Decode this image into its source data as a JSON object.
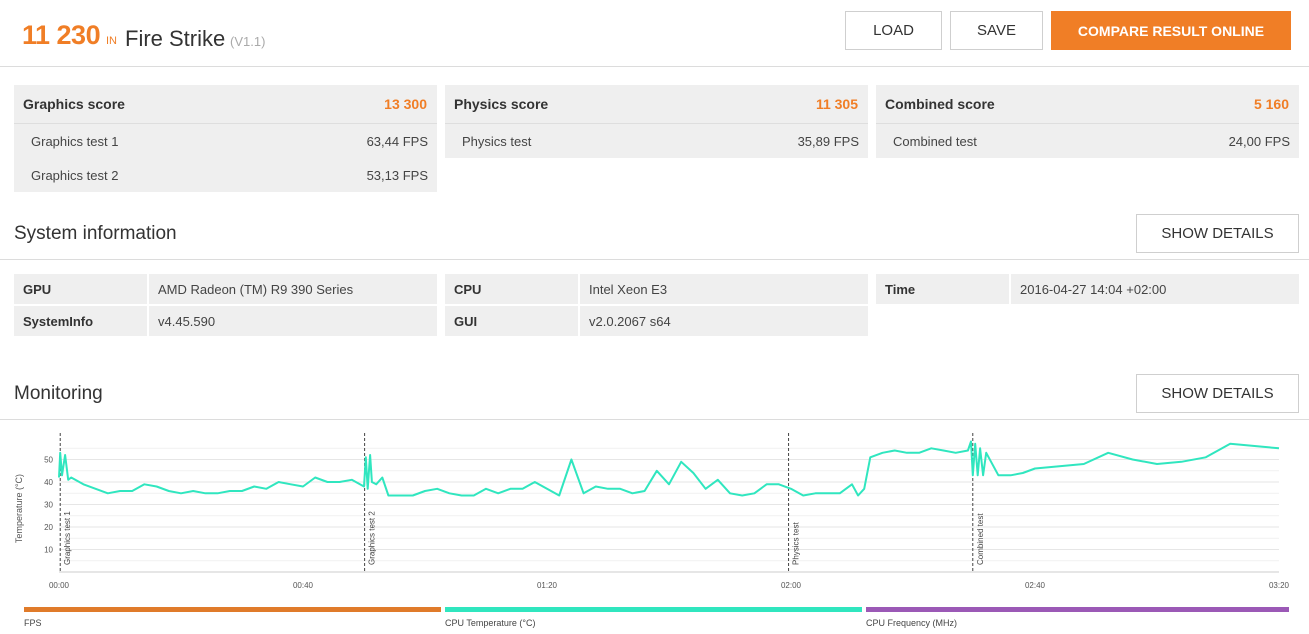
{
  "header": {
    "score": "11 230",
    "in_label": "IN",
    "benchmark": "Fire Strike",
    "version": "(V1.1)",
    "buttons": {
      "load": "LOAD",
      "save": "SAVE",
      "compare": "COMPARE RESULT ONLINE"
    }
  },
  "scores": [
    {
      "title": "Graphics score",
      "value": "13 300",
      "rows": [
        {
          "label": "Graphics test 1",
          "value": "63,44 FPS"
        },
        {
          "label": "Graphics test 2",
          "value": "53,13 FPS"
        }
      ]
    },
    {
      "title": "Physics score",
      "value": "11 305",
      "rows": [
        {
          "label": "Physics test",
          "value": "35,89 FPS"
        }
      ]
    },
    {
      "title": "Combined score",
      "value": "5 160",
      "rows": [
        {
          "label": "Combined test",
          "value": "24,00 FPS"
        }
      ]
    }
  ],
  "system_info": {
    "title": "System information",
    "details_button": "SHOW DETAILS",
    "rows": [
      {
        "k1": "GPU",
        "v1": "AMD Radeon (TM) R9 390 Series",
        "k2": "CPU",
        "v2": "Intel Xeon E3",
        "k3": "Time",
        "v3": "2016-04-27 14:04 +02:00"
      },
      {
        "k1": "SystemInfo",
        "v1": "v4.45.590",
        "k2": "GUI",
        "v2": "v2.0.2067 s64"
      }
    ]
  },
  "monitoring": {
    "title": "Monitoring",
    "details_button": "SHOW DETAILS",
    "legend": [
      {
        "label": "FPS",
        "color": "#e07b2a"
      },
      {
        "label": "CPU Temperature (°C)",
        "color": "#30e6bf"
      },
      {
        "label": "CPU Frequency (MHz)",
        "color": "#9b59b6"
      }
    ]
  },
  "chart_data": {
    "type": "line",
    "ylabel": "Temperature (°C)",
    "y_ticks": [
      10,
      20,
      30,
      40,
      50
    ],
    "ylim": [
      0,
      60
    ],
    "x_ticks": [
      "00:00",
      "00:40",
      "01:20",
      "02:00",
      "02:40",
      "03:20"
    ],
    "xlim_seconds": [
      0,
      200
    ],
    "grid": true,
    "markers": [
      {
        "t": 0.2,
        "label": "Graphics test 1"
      },
      {
        "t": 50.1,
        "label": "Graphics test 2"
      },
      {
        "t": 119.6,
        "label": "Physics test"
      },
      {
        "t": 149.8,
        "label": "Combined test"
      }
    ],
    "series": [
      {
        "name": "CPU Temperature (°C)",
        "color": "#30e6bf",
        "points": [
          [
            0,
            42
          ],
          [
            0.2,
            53
          ],
          [
            0.5,
            43
          ],
          [
            1,
            52
          ],
          [
            1.5,
            41
          ],
          [
            2,
            42
          ],
          [
            4,
            39
          ],
          [
            6,
            37
          ],
          [
            8,
            35
          ],
          [
            10,
            36
          ],
          [
            12,
            36
          ],
          [
            14,
            39
          ],
          [
            16,
            38
          ],
          [
            18,
            36
          ],
          [
            20,
            35
          ],
          [
            22,
            36
          ],
          [
            24,
            35
          ],
          [
            26,
            35
          ],
          [
            28,
            36
          ],
          [
            30,
            36
          ],
          [
            32,
            38
          ],
          [
            34,
            37
          ],
          [
            36,
            40
          ],
          [
            38,
            39
          ],
          [
            40,
            38
          ],
          [
            42,
            42
          ],
          [
            44,
            40
          ],
          [
            46,
            40
          ],
          [
            48,
            41
          ],
          [
            50,
            38
          ],
          [
            50.3,
            51
          ],
          [
            50.6,
            37
          ],
          [
            51,
            52
          ],
          [
            51.3,
            40
          ],
          [
            52,
            39
          ],
          [
            53,
            42
          ],
          [
            54,
            34
          ],
          [
            56,
            34
          ],
          [
            58,
            34
          ],
          [
            60,
            36
          ],
          [
            62,
            37
          ],
          [
            64,
            35
          ],
          [
            66,
            34
          ],
          [
            68,
            34
          ],
          [
            70,
            37
          ],
          [
            72,
            35
          ],
          [
            74,
            37
          ],
          [
            76,
            37
          ],
          [
            78,
            40
          ],
          [
            80,
            37
          ],
          [
            82,
            34
          ],
          [
            84,
            50
          ],
          [
            86,
            35
          ],
          [
            88,
            38
          ],
          [
            90,
            37
          ],
          [
            92,
            37
          ],
          [
            94,
            35
          ],
          [
            96,
            36
          ],
          [
            98,
            45
          ],
          [
            100,
            39
          ],
          [
            102,
            49
          ],
          [
            104,
            44
          ],
          [
            106,
            37
          ],
          [
            108,
            41
          ],
          [
            110,
            35
          ],
          [
            112,
            34
          ],
          [
            114,
            35
          ],
          [
            116,
            39
          ],
          [
            118,
            39
          ],
          [
            120,
            37
          ],
          [
            122,
            34
          ],
          [
            124,
            35
          ],
          [
            126,
            35
          ],
          [
            128,
            35
          ],
          [
            130,
            39
          ],
          [
            131,
            34
          ],
          [
            132,
            37
          ],
          [
            133,
            51
          ],
          [
            135,
            53
          ],
          [
            137,
            54
          ],
          [
            139,
            53
          ],
          [
            141,
            53
          ],
          [
            143,
            55
          ],
          [
            145,
            54
          ],
          [
            147,
            53
          ],
          [
            149,
            54
          ],
          [
            149.5,
            58
          ],
          [
            149.8,
            43
          ],
          [
            150.2,
            57
          ],
          [
            150.6,
            43
          ],
          [
            151,
            55
          ],
          [
            151.5,
            43
          ],
          [
            152,
            53
          ],
          [
            154,
            43
          ],
          [
            156,
            43
          ],
          [
            158,
            44
          ],
          [
            160,
            46
          ],
          [
            164,
            47
          ],
          [
            168,
            48
          ],
          [
            172,
            53
          ],
          [
            176,
            50
          ],
          [
            180,
            48
          ],
          [
            184,
            49
          ],
          [
            188,
            51
          ],
          [
            192,
            57
          ],
          [
            196,
            56
          ],
          [
            200,
            55
          ]
        ]
      }
    ]
  }
}
